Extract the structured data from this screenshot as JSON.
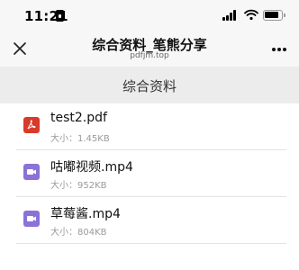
{
  "status_bar": {
    "time": "11:21"
  },
  "nav": {
    "title": "综合资料_笔熊分享",
    "subtitle": "pdfjm.top"
  },
  "section": {
    "title": "综合资料"
  },
  "files": [
    {
      "name": "test2.pdf",
      "size": "大小：1.45KB",
      "icon": "pdf-icon"
    },
    {
      "name": "咕嘟视频.mp4",
      "size": "大小：952KB",
      "icon": "video-icon"
    },
    {
      "name": "草莓酱.mp4",
      "size": "大小：804KB",
      "icon": "video-icon"
    }
  ],
  "colors": {
    "pdf_icon": "#d93a2a",
    "video_icon": "#8a72d7",
    "header_bg": "#f7f7f7",
    "section_bg": "#ececec"
  }
}
